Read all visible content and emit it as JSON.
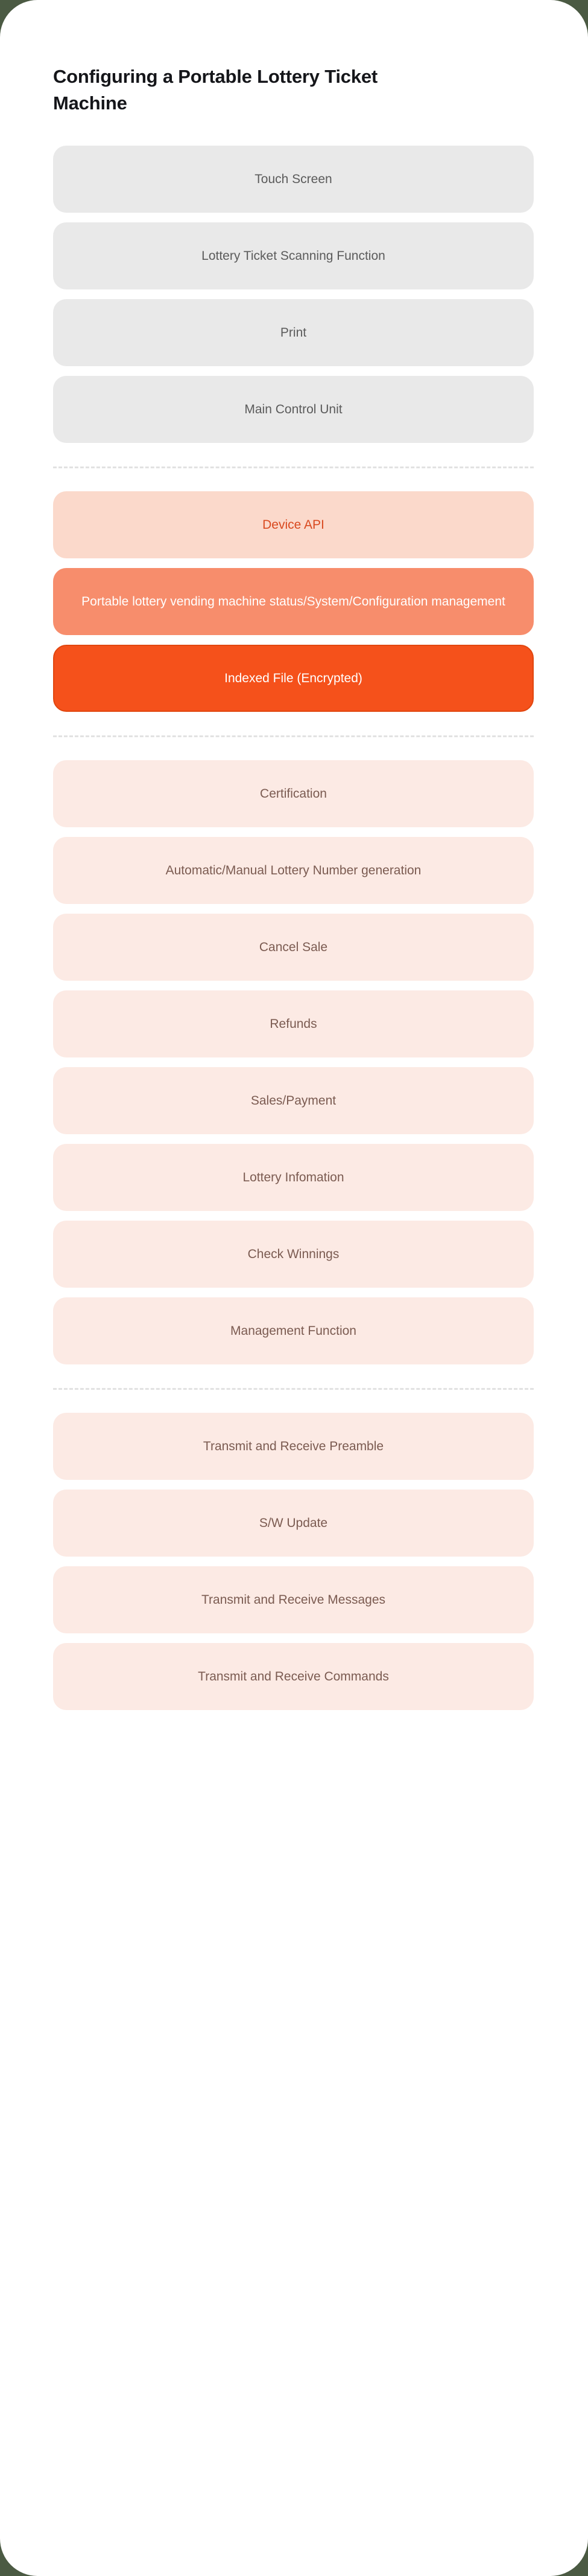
{
  "page": {
    "title": "Configuring a Portable Lottery Ticket Machine",
    "background_color": "#4b5a43",
    "card_color": "#ffffff"
  },
  "colors": {
    "hardware_bg": "#e9e9e9",
    "hardware_text": "#5b5b5b",
    "api_bg": "#fbd9cb",
    "api_text": "#d9491f",
    "status_bg": "#f78d6c",
    "status_text": "#ffffff",
    "indexed_bg": "#f5511b",
    "indexed_border": "#e1460f",
    "indexed_text": "#ffffff",
    "feature_bg": "#fceae4",
    "feature_text": "#7b5b51",
    "divider": "#e2e2e2"
  },
  "sections": [
    {
      "id": "hardware",
      "style": "hardware",
      "nodes": [
        {
          "label": "Touch Screen"
        },
        {
          "label": "Lottery Ticket Scanning Function"
        },
        {
          "label": "Print"
        },
        {
          "label": "Main Control Unit"
        }
      ]
    },
    {
      "id": "platform",
      "style": "mixed",
      "nodes": [
        {
          "label": "Device API",
          "style": "api"
        },
        {
          "label": "Portable lottery vending machine status/System/Configuration management",
          "style": "status"
        },
        {
          "label": "Indexed File (Encrypted)",
          "style": "indexed"
        }
      ]
    },
    {
      "id": "features",
      "style": "feature",
      "nodes": [
        {
          "label": "Certification"
        },
        {
          "label": "Automatic/Manual Lottery Number generation"
        },
        {
          "label": "Cancel Sale"
        },
        {
          "label": "Refunds"
        },
        {
          "label": "Sales/Payment"
        },
        {
          "label": "Lottery Infomation"
        },
        {
          "label": "Check Winnings"
        },
        {
          "label": "Management Function"
        }
      ]
    },
    {
      "id": "communication",
      "style": "feature",
      "nodes": [
        {
          "label": "Transmit and Receive Preamble"
        },
        {
          "label": "S/W Update"
        },
        {
          "label": "Transmit and Receive Messages"
        },
        {
          "label": "Transmit and Receive Commands"
        }
      ]
    }
  ]
}
